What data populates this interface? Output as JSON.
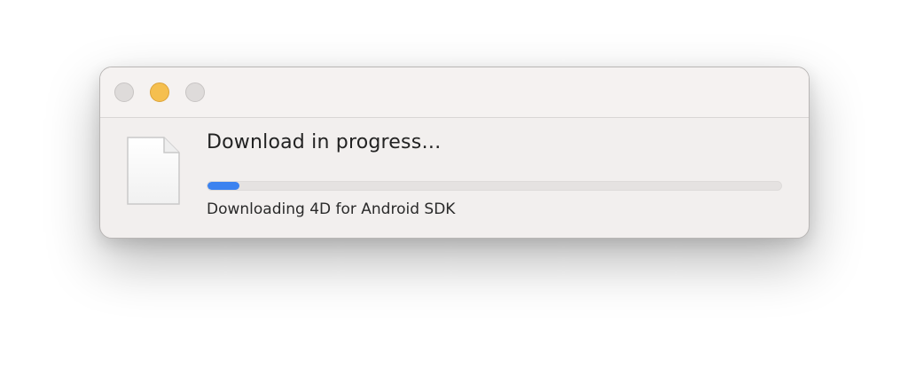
{
  "window": {
    "controls": {
      "close": "close-button",
      "minimize": "minimize-button",
      "zoom": "zoom-button"
    }
  },
  "dialog": {
    "title": "Download in progress…",
    "status": "Downloading 4D for Android SDK",
    "progress_fraction": 0.055,
    "icon": "document-icon"
  },
  "colors": {
    "progress_fill": "#3b82f0",
    "minimize_button": "#f5bf4f",
    "window_background": "#f2efee"
  }
}
